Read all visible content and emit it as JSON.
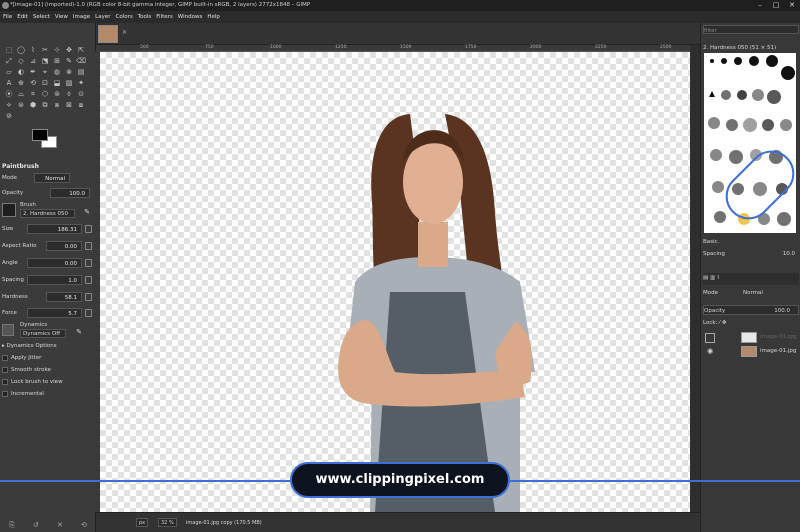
{
  "window": {
    "title": "*[image-01] (imported)-1.0 (RGB color 8-bit gamma integer, GIMP built-in sRGB, 2 layers) 2772x1848 – GIMP",
    "controls": [
      "–",
      "□",
      "✕"
    ]
  },
  "menu": [
    "File",
    "Edit",
    "Select",
    "View",
    "Image",
    "Layer",
    "Colors",
    "Tools",
    "Filters",
    "Windows",
    "Help"
  ],
  "tools": [
    "⬚",
    "◯",
    "⌇",
    "✂",
    "⊹",
    "✥",
    "⇱",
    "⤢",
    "◇",
    "⊿",
    "⬔",
    "⊞",
    "✎",
    "⌫",
    "▱",
    "◐",
    "✒",
    "⌖",
    "◍",
    "⊗",
    "▤",
    "A",
    "⊕",
    "⟲",
    "⊡",
    "⬓",
    "▨",
    "✦",
    "⦿",
    "⌓",
    "⌗",
    "⬡",
    "⊚",
    "⌽",
    "⊙",
    "⟡",
    "⊜",
    "⬢",
    "⧉",
    "⧈",
    "⊠",
    "⧇",
    "⊘"
  ],
  "tool_options": {
    "header": "Paintbrush",
    "mode_label": "Mode",
    "mode_value": "Normal",
    "opacity_label": "Opacity",
    "opacity_value": "100.0",
    "brush_label": "Brush",
    "brush_value": "2. Hardness 050",
    "size_label": "Size",
    "size_value": "186.31",
    "aspect_label": "Aspect Ratio",
    "aspect_value": "0.00",
    "angle_label": "Angle",
    "angle_value": "0.00",
    "spacing_label": "Spacing",
    "spacing_value": "1.0",
    "hardness_label": "Hardness",
    "hardness_value": "58.1",
    "force_label": "Force",
    "force_value": "5.7",
    "dynamics_label": "Dynamics",
    "dynamics_value": "Dynamics Off",
    "checkboxes": [
      "Dynamics Options",
      "Apply Jitter",
      "Smooth stroke",
      "Lock brush to view",
      "Incremental"
    ]
  },
  "rulers": [
    "500",
    "750",
    "1000",
    "1250",
    "1500",
    "1750",
    "2000",
    "2250",
    "2500"
  ],
  "status": {
    "unit": "px",
    "zoom": "32 %",
    "info": "image-01.jpg copy (170.5 MB)"
  },
  "brushes_panel": {
    "filter": "filter",
    "selected": "2. Hardness 050 (51 × 51)",
    "tag": "Basic.",
    "spacing_label": "Spacing",
    "spacing_value": "10.0"
  },
  "layers_panel": {
    "mode_label": "Mode",
    "mode_value": "Normal",
    "opacity_label": "Opacity",
    "opacity_value": "100.0",
    "lock_label": "Lock:",
    "layers": [
      {
        "name": "image-01.jpg"
      },
      {
        "name": "image-01.jpg"
      }
    ]
  },
  "watermark": {
    "text": "www.clippingpixel.com"
  },
  "colors": {
    "accent": "#3e6fd6",
    "canvas_bg": "#ffffff",
    "checker": "#e2e2e2"
  }
}
